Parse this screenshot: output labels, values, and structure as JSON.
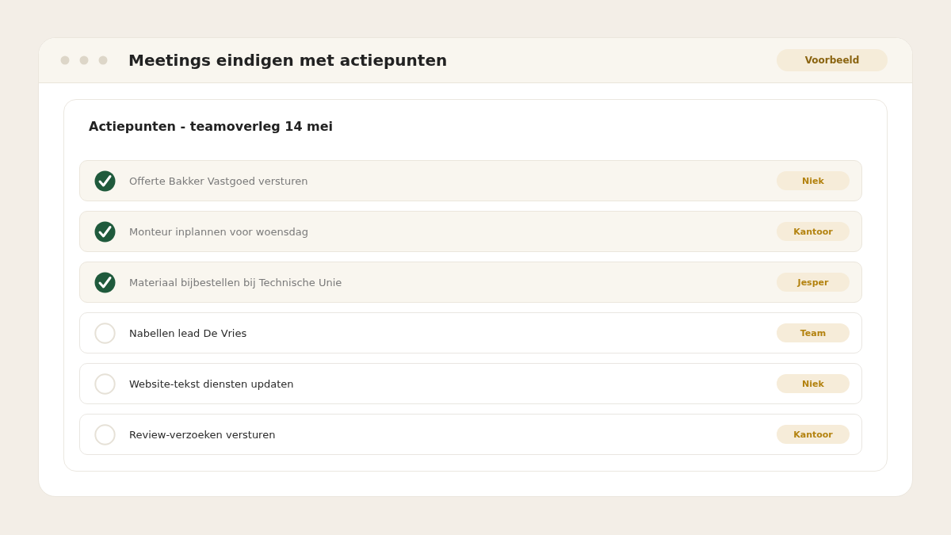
{
  "window": {
    "title": "Meetings eindigen met actiepunten",
    "badge": "Voorbeeld"
  },
  "card": {
    "title": "Actiepunten - teamoverleg 14 mei",
    "items": [
      {
        "text": "Offerte Bakker Vastgoed versturen",
        "checked": true,
        "assignee": "Niek"
      },
      {
        "text": "Monteur inplannen voor woensdag",
        "checked": true,
        "assignee": "Kantoor"
      },
      {
        "text": "Materiaal bijbestellen bij Technische Unie",
        "checked": true,
        "assignee": "Jesper"
      },
      {
        "text": "Nabellen lead De Vries",
        "checked": false,
        "assignee": "Team"
      },
      {
        "text": "Website-tekst diensten updaten",
        "checked": false,
        "assignee": "Niek"
      },
      {
        "text": "Review-verzoeken versturen",
        "checked": false,
        "assignee": "Kantoor"
      }
    ]
  }
}
